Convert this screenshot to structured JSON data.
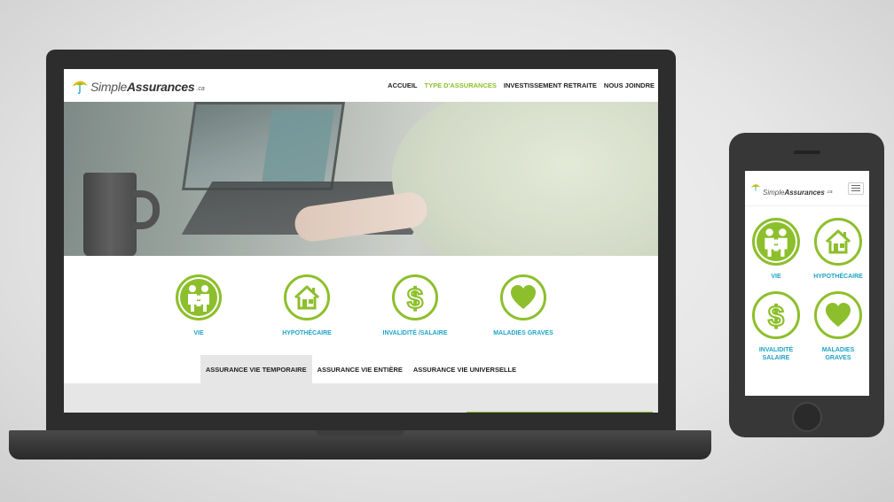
{
  "colors": {
    "accent_green": "#8dbf2c",
    "label_blue": "#1fa3c4",
    "device_dark": "#2d2d2d"
  },
  "site": {
    "logo": {
      "simple": "Simple",
      "assurances": "Assurances",
      "tld": ".ca"
    },
    "nav": [
      {
        "label": "ACCUEIL",
        "active": false
      },
      {
        "label": "TYPE D'ASSURANCES",
        "active": true
      },
      {
        "label": "INVESTISSEMENT RETRAITE",
        "active": false
      },
      {
        "label": "NOUS JOINDRE",
        "active": false
      }
    ],
    "categories": [
      {
        "label": "VIE",
        "icon": "family-icon"
      },
      {
        "label": "HYPOTHÉCAIRE",
        "icon": "house-icon"
      },
      {
        "label": "INVALIDITÉ /SALAIRE",
        "icon": "dollar-icon"
      },
      {
        "label": "MALADIES GRAVES",
        "icon": "heart-icon"
      }
    ],
    "tabs": [
      {
        "label": "ASSURANCE VIE TEMPORAIRE",
        "active": true
      },
      {
        "label": "ASSURANCE VIE ENTIÈRE",
        "active": false
      },
      {
        "label": "ASSURANCE VIE UNIVERSELLE",
        "active": false
      }
    ]
  },
  "mobile": {
    "categories": [
      {
        "label": "VIE",
        "icon": "family-icon"
      },
      {
        "label": "HYPOTHÉCAIRE",
        "icon": "house-icon"
      },
      {
        "label_line1": "INVALIDITÉ",
        "label_line2": "SALAIRE",
        "icon": "dollar-icon"
      },
      {
        "label_line1": "MALADIES",
        "label_line2": "GRAVES",
        "icon": "heart-icon"
      }
    ]
  }
}
